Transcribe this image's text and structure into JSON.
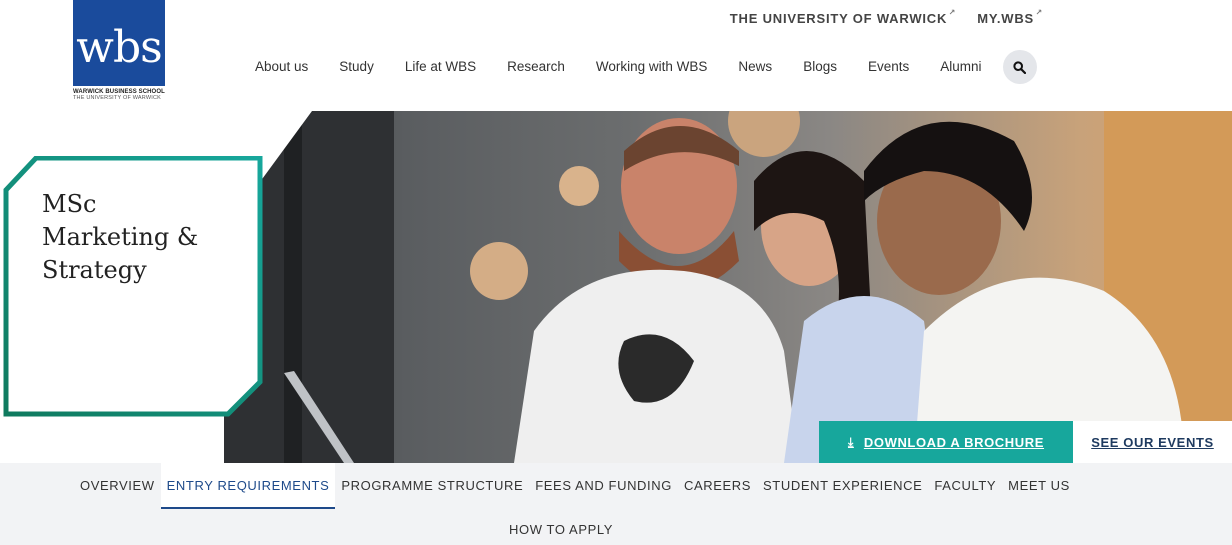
{
  "logo": {
    "mark": "wbs",
    "line1": "WARWICK BUSINESS SCHOOL",
    "line2": "THE UNIVERSITY OF WARWICK",
    "brand_color": "#1a4b9c"
  },
  "utility_links": [
    {
      "label": "THE UNIVERSITY OF WARWICK",
      "icon": "external-link-icon"
    },
    {
      "label": "MY.WBS",
      "icon": "external-link-icon"
    }
  ],
  "main_nav": [
    "About us",
    "Study",
    "Life at WBS",
    "Research",
    "Working with WBS",
    "News",
    "Blogs",
    "Events",
    "Alumni"
  ],
  "search": {
    "icon": "search-icon"
  },
  "hero": {
    "title": "MSc Marketing & Strategy",
    "accent_color": "#17a79c"
  },
  "cta": {
    "brochure": "DOWNLOAD A BROCHURE",
    "brochure_icon": "download-icon",
    "events": "SEE OUR EVENTS"
  },
  "sub_nav": {
    "items": [
      "OVERVIEW",
      "ENTRY REQUIREMENTS",
      "PROGRAMME STRUCTURE",
      "FEES AND FUNDING",
      "CAREERS",
      "STUDENT EXPERIENCE",
      "FACULTY",
      "MEET US"
    ],
    "active": "ENTRY REQUIREMENTS",
    "second_row": "HOW TO APPLY"
  }
}
